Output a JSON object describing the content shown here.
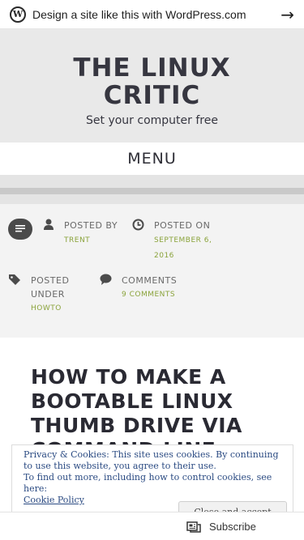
{
  "wp_bar": {
    "text": "Design a site like this with WordPress.com",
    "logo": "wordpress-logo",
    "arrow_icon": "arrow-right-icon"
  },
  "site": {
    "title": "THE LINUX CRITIC",
    "tagline": "Set your computer free"
  },
  "menu": {
    "label": "MENU"
  },
  "meta": {
    "format_icon": "standard-post-icon",
    "posted_by_label": "POSTED BY",
    "author": "TRENT",
    "posted_on_label": "POSTED ON",
    "date": "SEPTEMBER 6, 2016",
    "posted_under_label": "POSTED UNDER",
    "category": "HOWTO",
    "comments_label": "COMMENTS",
    "comments_count": "9 COMMENTS"
  },
  "post": {
    "title": "HOW TO MAKE A BOOTABLE LINUX THUMB DRIVE VIA COMMAND LINE"
  },
  "cookie_banner": {
    "text1": "Privacy & Cookies: This site uses cookies. By continuing to use this website, you agree to their use.",
    "text2": "To find out more, including how to control cookies, see here:",
    "link": "Cookie Policy",
    "close_label": "Close and accept"
  },
  "subscribe": {
    "label": "Subscribe",
    "icon": "reader-icon"
  }
}
